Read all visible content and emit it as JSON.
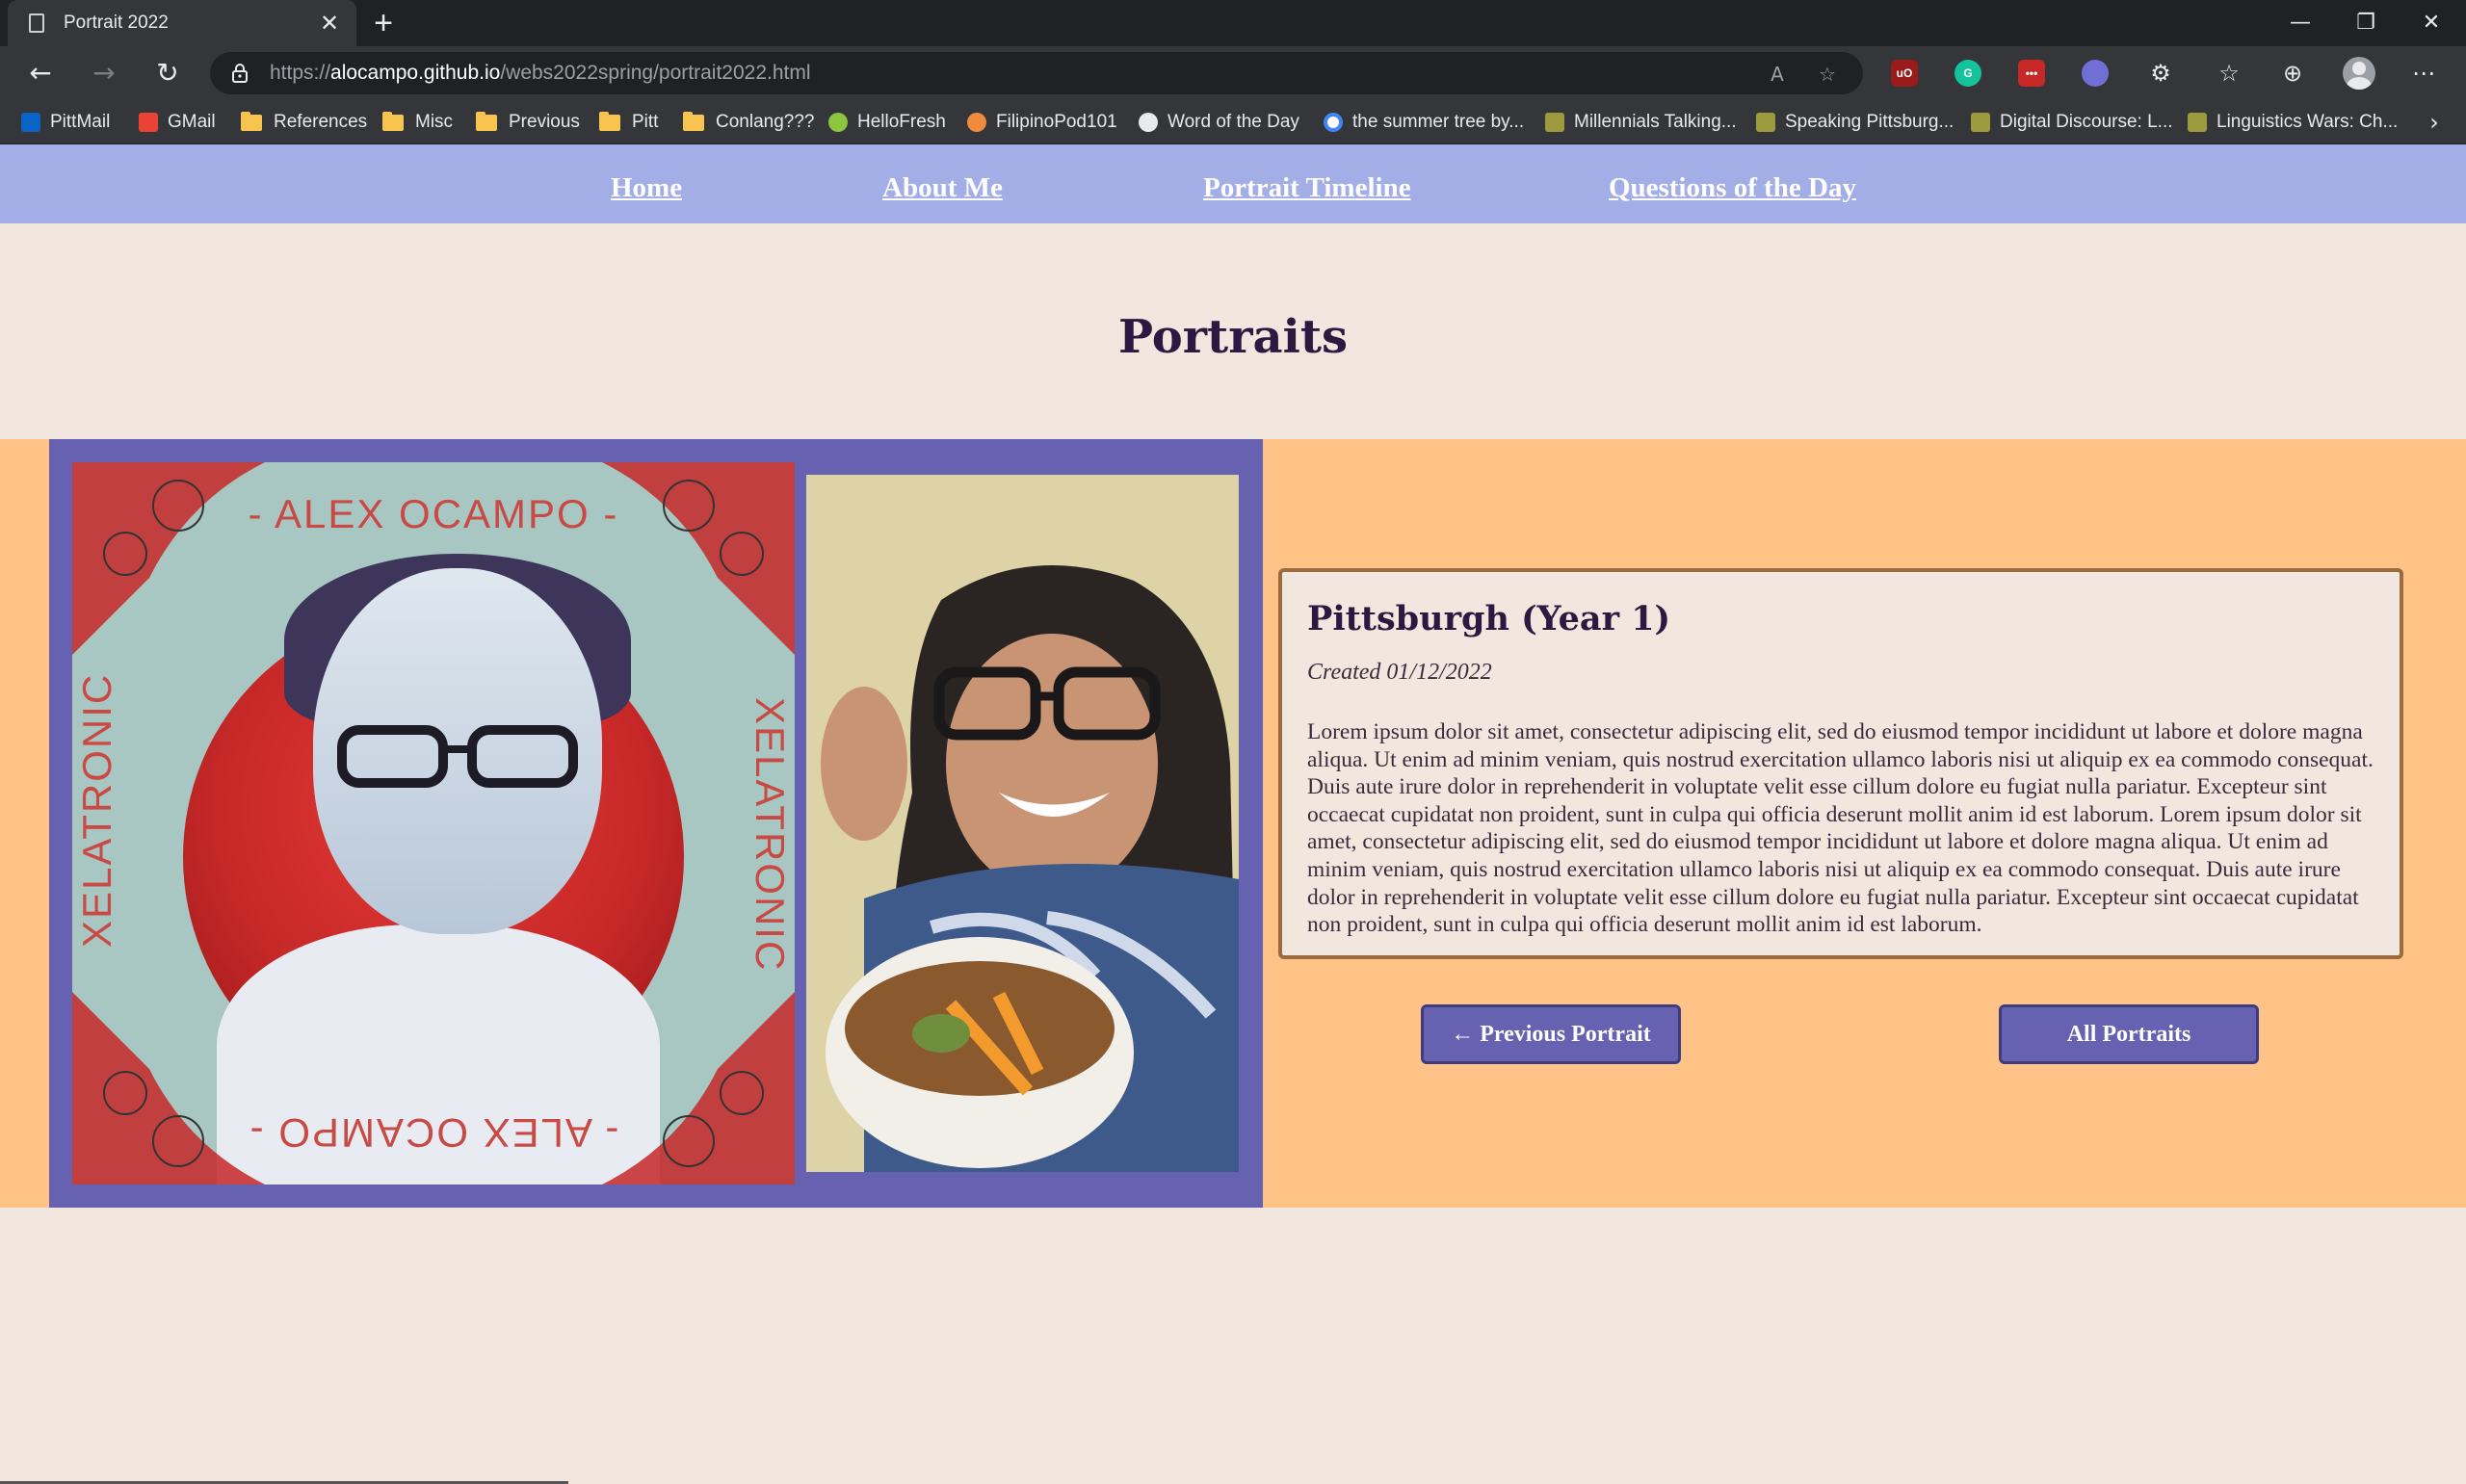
{
  "browser": {
    "tab_title": "Portrait 2022",
    "tab_close": "✕",
    "new_tab": "+",
    "url_scheme": "https://",
    "url_host": "alocampo.github.io",
    "url_path": "/webs2022spring/portrait2022.html",
    "window_controls": [
      "—",
      "❐",
      "✕"
    ],
    "bookmarks": [
      {
        "label": "PittMail",
        "icon": "outlook-icon",
        "color": "#0a64c8"
      },
      {
        "label": "GMail",
        "icon": "gmail-icon",
        "color": "#ea4335"
      },
      {
        "label": "References",
        "icon": "folder-icon"
      },
      {
        "label": "Misc",
        "icon": "folder-icon"
      },
      {
        "label": "Previous",
        "icon": "folder-icon"
      },
      {
        "label": "Pitt",
        "icon": "folder-icon"
      },
      {
        "label": "Conlang???",
        "icon": "folder-icon"
      },
      {
        "label": "HelloFresh",
        "icon": "hellofresh-icon",
        "color": "#8cc63f"
      },
      {
        "label": "FilipinoPod101",
        "icon": "filipinopod-icon",
        "color": "#f08a3c"
      },
      {
        "label": "Word of the Day",
        "icon": "mw-icon",
        "color": "#e8eaed"
      },
      {
        "label": "the summer tree by...",
        "icon": "google-icon",
        "color": "#4285f4"
      },
      {
        "label": "Millennials Talking...",
        "icon": "upso-icon",
        "color": "#9c9a3c"
      },
      {
        "label": "Speaking Pittsburg...",
        "icon": "upso-icon",
        "color": "#9c9a3c"
      },
      {
        "label": "Digital Discourse: L...",
        "icon": "upso-icon",
        "color": "#9c9a3c"
      },
      {
        "label": "Linguistics Wars: Ch...",
        "icon": "upso-icon",
        "color": "#9c9a3c"
      }
    ]
  },
  "nav": {
    "items": [
      "Home",
      "About Me",
      "Portrait Timeline",
      "Questions of the Day"
    ]
  },
  "page": {
    "title": "Portraits"
  },
  "artwork": {
    "top_text": "- ALEX OCAMPO -",
    "bottom_text": "- ALEX OCAMPO -",
    "side_text": "XELATRONIC"
  },
  "portrait": {
    "title": "Pittsburgh (Year 1)",
    "date": "Created 01/12/2022",
    "body": "Lorem ipsum dolor sit amet, consectetur adipiscing elit, sed do eiusmod tempor incididunt ut labore et dolore magna aliqua. Ut enim ad minim veniam, quis nostrud exercitation ullamco laboris nisi ut aliquip ex ea commodo consequat. Duis aute irure dolor in reprehenderit in voluptate velit esse cillum dolore eu fugiat nulla pariatur. Excepteur sint occaecat cupidatat non proident, sunt in culpa qui officia deserunt mollit anim id est laborum. Lorem ipsum dolor sit amet, consectetur adipiscing elit, sed do eiusmod tempor incididunt ut labore et dolore magna aliqua. Ut enim ad minim veniam, quis nostrud exercitation ullamco laboris nisi ut aliquip ex ea commodo consequat. Duis aute irure dolor in reprehenderit in voluptate velit esse cillum dolore eu fugiat nulla pariatur. Excepteur sint occaecat cupidatat non proident, sunt in culpa qui officia deserunt mollit anim id est laborum."
  },
  "buttons": {
    "previous": "← Previous Portrait",
    "all": "All Portraits"
  },
  "colors": {
    "nav_bg": "#a4aee6",
    "band_bg": "#ffc387",
    "frame": "#6761b2",
    "page_bg": "#f1e7de",
    "heading": "#2c1840",
    "card_border": "#9b6a3f"
  }
}
